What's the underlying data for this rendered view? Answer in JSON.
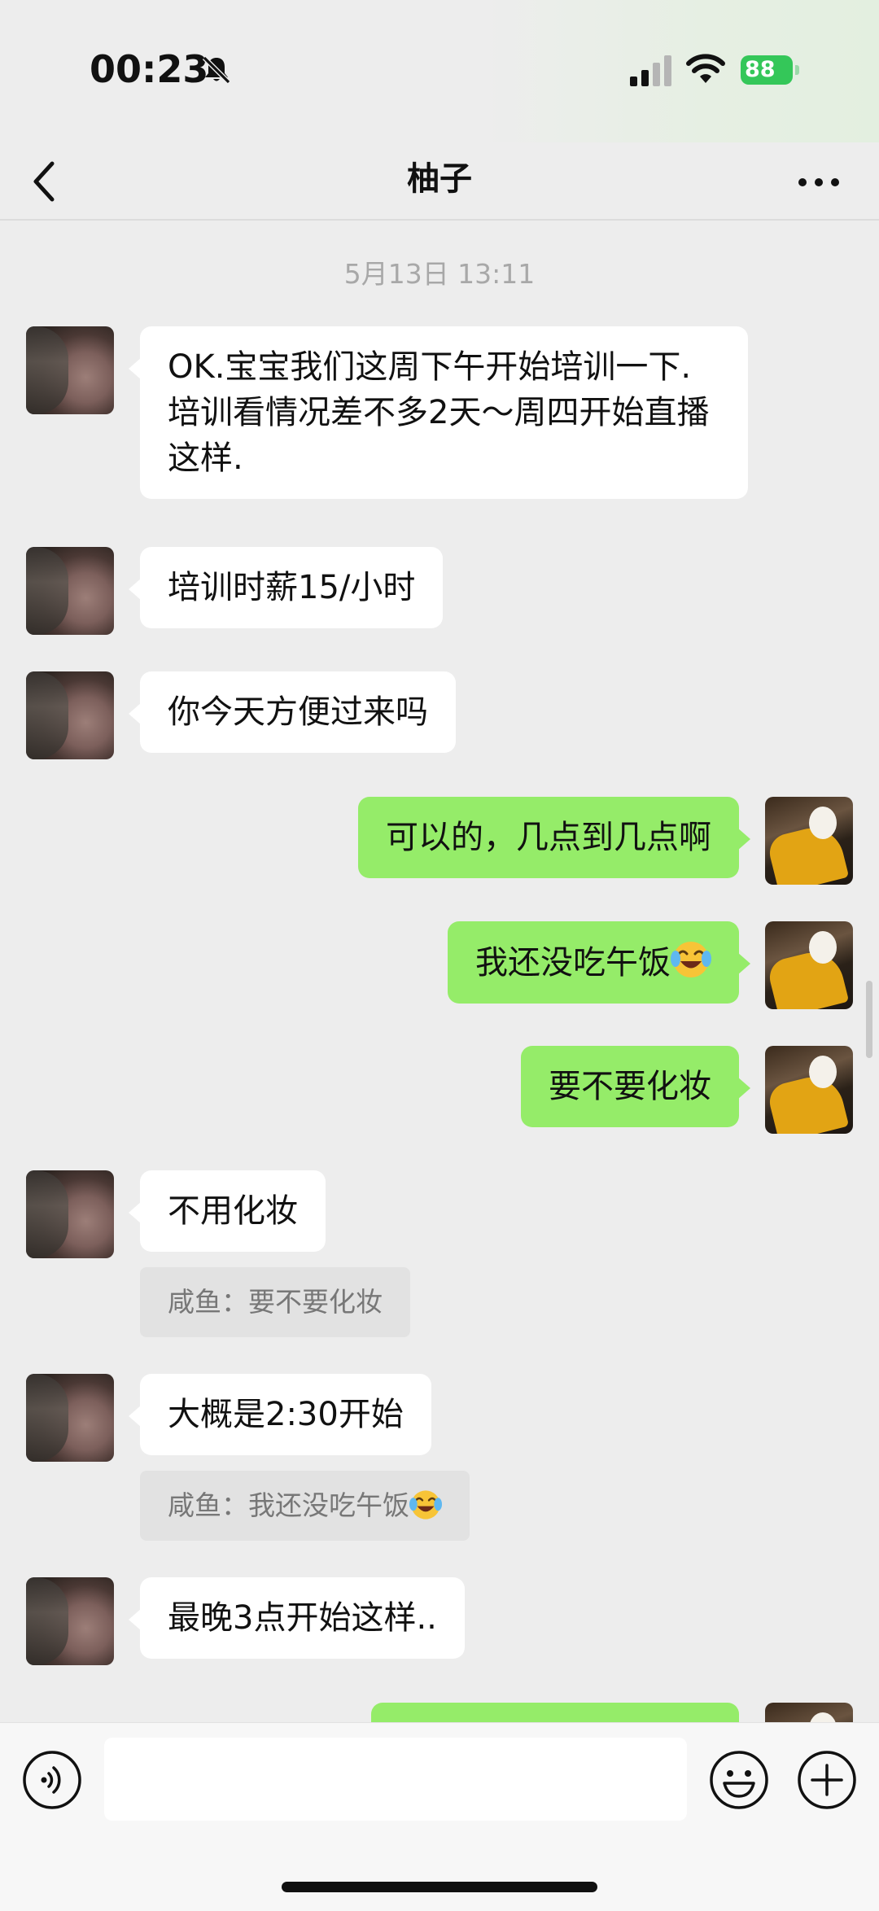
{
  "status_bar": {
    "time": "00:23",
    "battery": "88",
    "icons": [
      "bell-muted-icon",
      "cellular-signal-icon",
      "wifi-icon",
      "battery-charging-icon"
    ]
  },
  "nav": {
    "title": "柚子",
    "back_icon": "chevron-left-icon",
    "more_icon": "more-dots-icon"
  },
  "timestamp": "5月13日 13:11",
  "messages": [
    {
      "from": "contact",
      "text": "OK.宝宝我们这周下午开始培训一下.培训看情况差不多2天～周四开始直播这样."
    },
    {
      "from": "contact",
      "text": "培训时薪15/小时"
    },
    {
      "from": "contact",
      "text": "你今天方便过来吗"
    },
    {
      "from": "me",
      "text": "可以的，几点到几点啊"
    },
    {
      "from": "me",
      "text": "我还没吃午饭",
      "emoji": "tears-of-joy-emoji"
    },
    {
      "from": "me",
      "text": "要不要化妆"
    },
    {
      "from": "contact",
      "text": "不用化妆",
      "quote": "咸鱼：要不要化妆"
    },
    {
      "from": "contact",
      "text": "大概是2:30开始",
      "quote": "咸鱼：我还没吃午饭",
      "quote_emoji": "tears-of-joy-emoji"
    },
    {
      "from": "contact",
      "text": "最晚3点开始这样.."
    },
    {
      "from": "me",
      "text": ""
    }
  ],
  "input_bar": {
    "placeholder": "",
    "value": "",
    "icons": [
      "voice-icon",
      "emoji-smiley-icon",
      "plus-icon"
    ]
  },
  "colors": {
    "outgoing_bubble": "#95ec69",
    "incoming_bubble": "#ffffff",
    "background": "#ededed",
    "battery": "#34c759"
  }
}
